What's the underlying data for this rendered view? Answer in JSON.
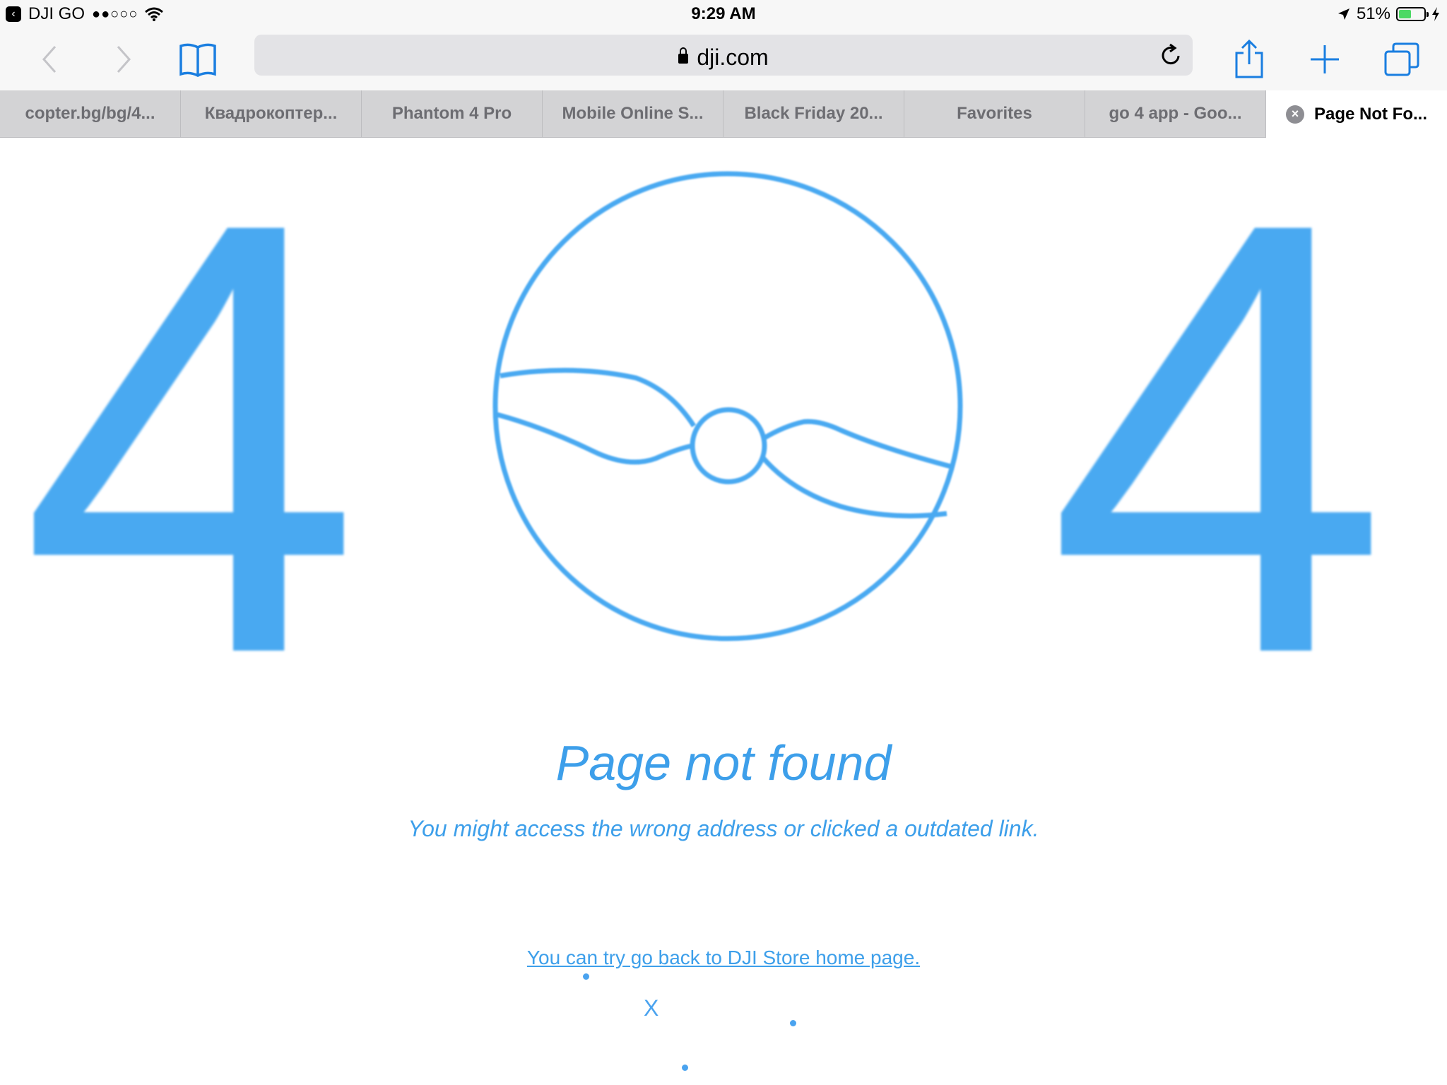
{
  "status_bar": {
    "back_app": "DJI GO",
    "signal": "●●○○○",
    "time": "9:29 AM",
    "battery": "51%",
    "battery_level": 0.51
  },
  "toolbar": {
    "url": "dji.com"
  },
  "tabs": [
    {
      "label": "copter.bg/bg/4..."
    },
    {
      "label": "Квадрокоптер..."
    },
    {
      "label": "Phantom 4 Pro"
    },
    {
      "label": "Mobile Online S..."
    },
    {
      "label": "Black Friday 20..."
    },
    {
      "label": "Favorites"
    },
    {
      "label": "go 4 app - Goo..."
    },
    {
      "label": "Page Not Fo...",
      "active": true
    }
  ],
  "page": {
    "digit_left": "4",
    "digit_right": "4",
    "title": "Page not found",
    "subtitle": "You might access the wrong address or clicked a outdated link.",
    "home_link": "You can try go back to DJI Store home page.",
    "stray_mark": "X"
  },
  "colors": {
    "accent": "#49a9f1",
    "ios_blue": "#1a7ee0"
  }
}
